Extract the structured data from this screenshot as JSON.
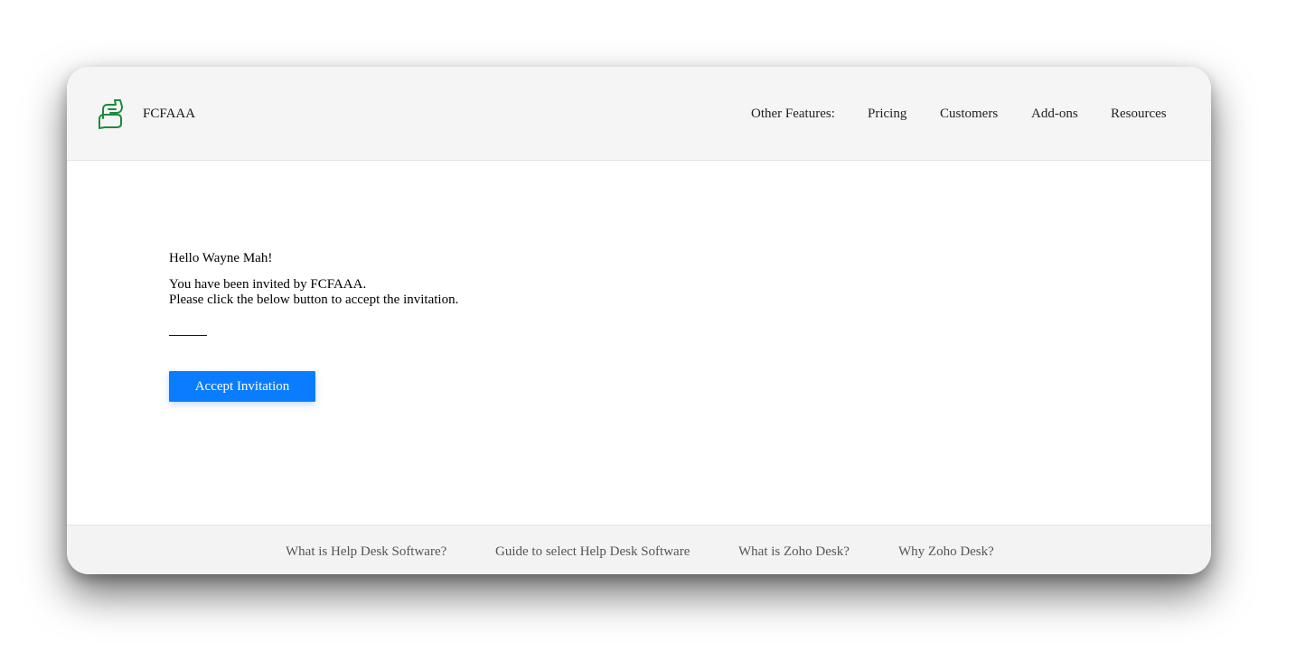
{
  "header": {
    "brand": "FCFAAA",
    "logo_icon": "chat-bubbles-icon",
    "logo_color": "#1a8c3a",
    "nav": {
      "other_features": "Other Features:",
      "pricing": "Pricing",
      "customers": "Customers",
      "addons": "Add-ons",
      "resources": "Resources"
    }
  },
  "main": {
    "greeting": "Hello Wayne Mah!",
    "invited_line": "You have been invited by FCFAAA.",
    "instruction_line": "Please click the below button to accept the invitation.",
    "accept_button": "Accept Invitation",
    "accent_color": "#0a7cff"
  },
  "footer": {
    "links": {
      "help_desk": "What is Help Desk Software?",
      "guide": "Guide to select Help Desk Software",
      "zoho_desk": "What is Zoho Desk?",
      "why_zoho": "Why Zoho Desk?"
    }
  }
}
